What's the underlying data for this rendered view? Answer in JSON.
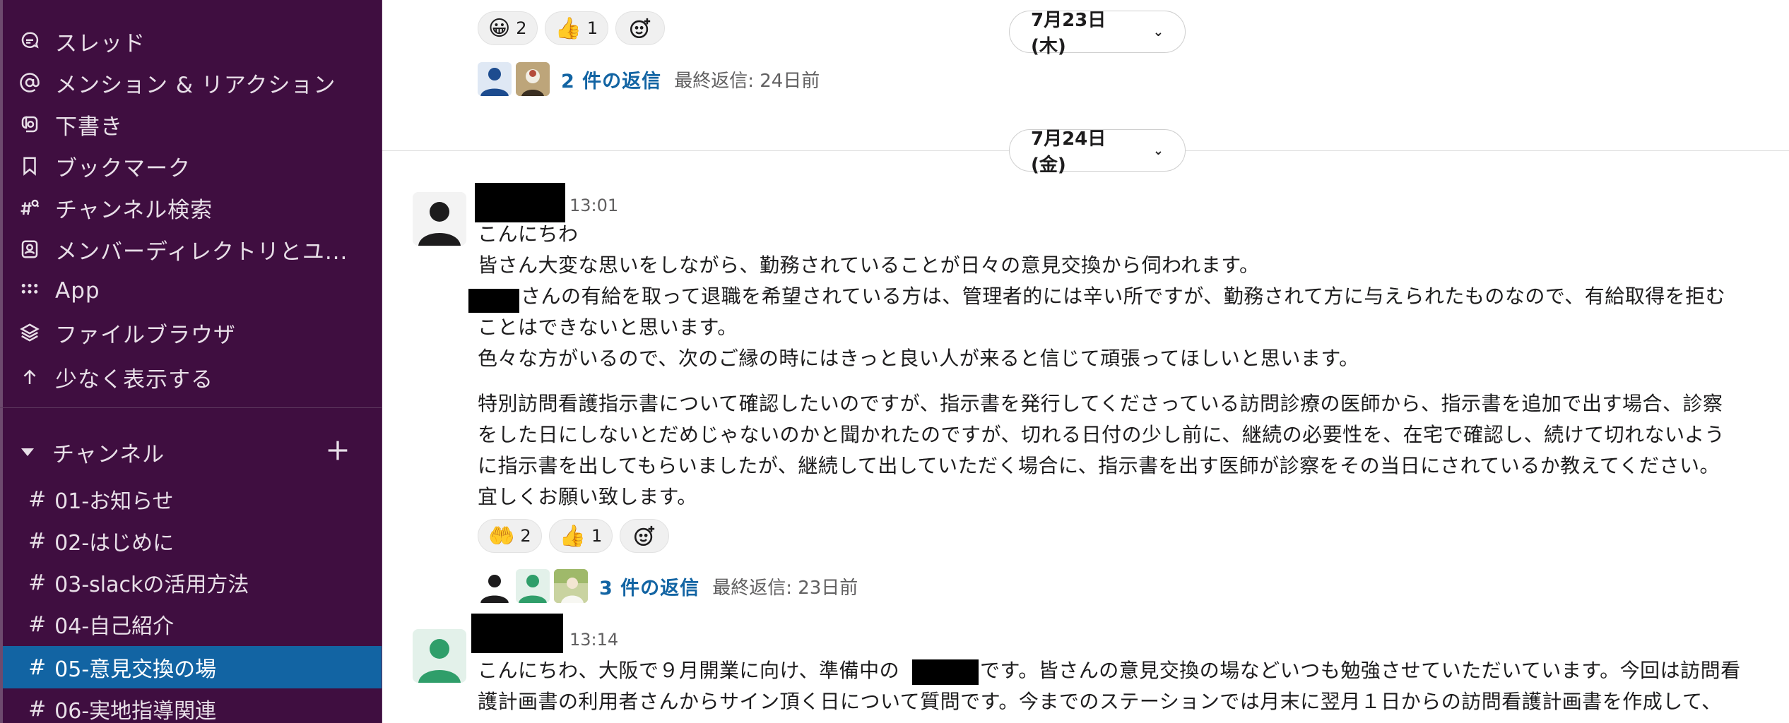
{
  "sidebar": {
    "nav": [
      {
        "label": "スレッド",
        "icon": "threads-icon"
      },
      {
        "label": "メンション & リアクション",
        "icon": "at-icon"
      },
      {
        "label": "下書き",
        "icon": "drafts-icon"
      },
      {
        "label": "ブックマーク",
        "icon": "bookmark-icon"
      },
      {
        "label": "チャンネル検索",
        "icon": "channel-search-icon"
      },
      {
        "label": "メンバーディレクトリとユ...",
        "icon": "member-directory-icon"
      },
      {
        "label": "App",
        "icon": "apps-grid-icon"
      },
      {
        "label": "ファイルブラウザ",
        "icon": "layers-icon"
      },
      {
        "label": "少なく表示する",
        "icon": "arrow-up-icon"
      }
    ],
    "section_label": "チャンネル",
    "channels": [
      {
        "name": "01-お知らせ"
      },
      {
        "name": "02-はじめに"
      },
      {
        "name": "03-slackの活用方法"
      },
      {
        "name": "04-自己紹介"
      },
      {
        "name": "05-意見交換の場",
        "active": true
      },
      {
        "name": "06-実地指導関連"
      }
    ],
    "hash": "#",
    "colors": {
      "background": "#3f0e40",
      "active": "#1264a3"
    }
  },
  "main": {
    "top_thread": {
      "reactions": [
        {
          "emoji": "😀",
          "count": "2"
        },
        {
          "emoji": "👍",
          "count": "1"
        }
      ],
      "reply_count": "2 件の返信",
      "last_reply": "最終返信: 24日前"
    },
    "dates": {
      "first": "7月23日 (木)",
      "second": "7月24日 (金)"
    },
    "message1": {
      "time": "13:01",
      "lines": [
        "こんにちわ",
        "皆さん大変な思いをしながら、勤務されていることが日々の意見交換から伺われます。",
        "さんの有給を取って退職を希望されている方は、管理者的には辛い所ですが、勤務されて方に与えられたものなので、有給取得を拒む",
        "ことはできないと思います。",
        "色々な方がいるので、次のご縁の時にはきっと良い人が来ると信じて頑張ってほしいと思います。",
        "特別訪問看護指示書について確認したいのですが、指示書を発行してくださっている訪問診療の医師から、指示書を追加で出す場合、診察",
        "をした日にしないとだめじゃないのかと聞かれたのですが、切れる日付の少し前に、継続の必要性を、在宅で確認し、続けて切れないよう",
        "に指示書を出してもらいましたが、継続して出していただく場合に、指示書を出す医師が診察をその当日にされているか教えてください。",
        "宜しくお願い致します。"
      ],
      "reactions": [
        {
          "emoji": "🤲",
          "count": "2"
        },
        {
          "emoji": "👍",
          "count": "1"
        }
      ],
      "reply_count": "3 件の返信",
      "last_reply": "最終返信: 23日前"
    },
    "message2": {
      "time": "13:14",
      "line1_a": "こんにちわ、大阪で９月開業に向け、準備中の",
      "line1_b": "です。皆さんの意見交換の場などいつも勉強させていただいています。今回は訪問看",
      "line2": "護計画書の利用者さんからサイン頂く日について質問です。今までのステーションでは月末に翌月１日からの訪問看護計画書を作成して、"
    }
  }
}
